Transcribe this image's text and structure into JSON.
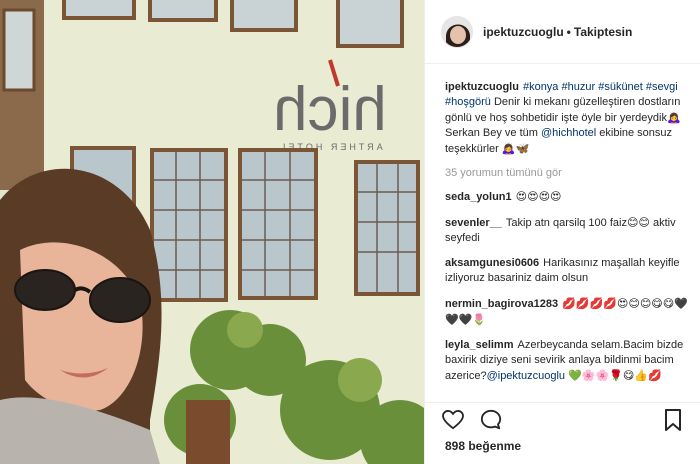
{
  "post": {
    "username": "ipektuzcuoglu",
    "separator": "•",
    "follow_status": "Takiptesin",
    "sign_text": "hich",
    "sign_subtext": "ARTHER HOTEL"
  },
  "caption": {
    "username": "ipektuzcuoglu",
    "hashtags": [
      "#konya",
      "#huzur",
      "#sükünet",
      "#sevgi",
      "#hoşgörü"
    ],
    "text_part1": "Denir ki mekanı güzelleştiren dostların gönlü ve hoş sohbetidir işte öyle bir yerdeydik",
    "emoji1": "🙇‍♀️",
    "text_part2": "Serkan Bey ve tüm",
    "mention": "@hichhotel",
    "text_part3": "ekibine sonsuz teşekkürler",
    "emoji2": "🙇‍♀️🦋"
  },
  "view_all": "35 yorumun tümünü gör",
  "comments": [
    {
      "user": "seda_yolun1",
      "text": "",
      "emoji": "😍😍😍😍"
    },
    {
      "user": "sevenler__",
      "text": "Takip atn qarsilq 100 faiz",
      "emoji": "😊😊",
      "text2": " aktiv seyfedi"
    },
    {
      "user": "aksamgunesi0606",
      "text": "Harikasınız maşallah keyifle izliyoruz basariniz daim olsun",
      "emoji": ""
    },
    {
      "user": "nermin_bagirova1283",
      "text": "",
      "emoji": "💋💋💋💋😍😊😊😋😋🖤🖤🖤🌷"
    },
    {
      "user": "leyla_selimm",
      "text": "Azerbeycanda selam.Bacim bizde baxirik diziye seni sevirik anlaya bildinmi bacim azerice?",
      "mention": "@ipektuzcuoglu",
      "emoji": "💚🌸🌸🌹😋👍💋"
    }
  ],
  "likes": "898 beğenme",
  "icons": {
    "like": "heart-icon",
    "comment": "comment-icon",
    "save": "bookmark-icon"
  }
}
